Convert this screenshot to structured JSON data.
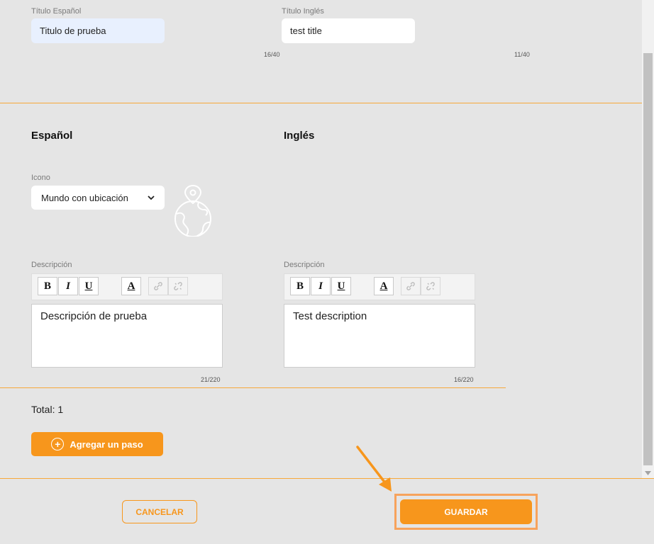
{
  "titles": {
    "es_label": "Título Español",
    "es_value": "Titulo de prueba",
    "es_counter": "16/40",
    "en_label": "Título Inglés",
    "en_value": "test title",
    "en_counter": "11/40"
  },
  "sections": {
    "es_heading": "Español",
    "en_heading": "Inglés"
  },
  "icon_field": {
    "label": "Icono",
    "selected": "Mundo con ubicación",
    "icon": "globe-with-location-pin"
  },
  "description": {
    "es_label": "Descripción",
    "es_text": "Descripción de prueba",
    "es_counter": "21/220",
    "en_label": "Descripción",
    "en_text": "Test description",
    "en_counter": "16/220"
  },
  "toolbar": {
    "bold": "B",
    "italic": "I",
    "underline": "U",
    "font_color": "A"
  },
  "total": {
    "text": "Total: 1"
  },
  "buttons": {
    "add_step": "Agregar un paso",
    "cancel": "CANCELAR",
    "save": "GUARDAR"
  },
  "colors": {
    "accent": "#f7961c",
    "divider": "#f7a83a",
    "background": "#e5e5e5"
  }
}
